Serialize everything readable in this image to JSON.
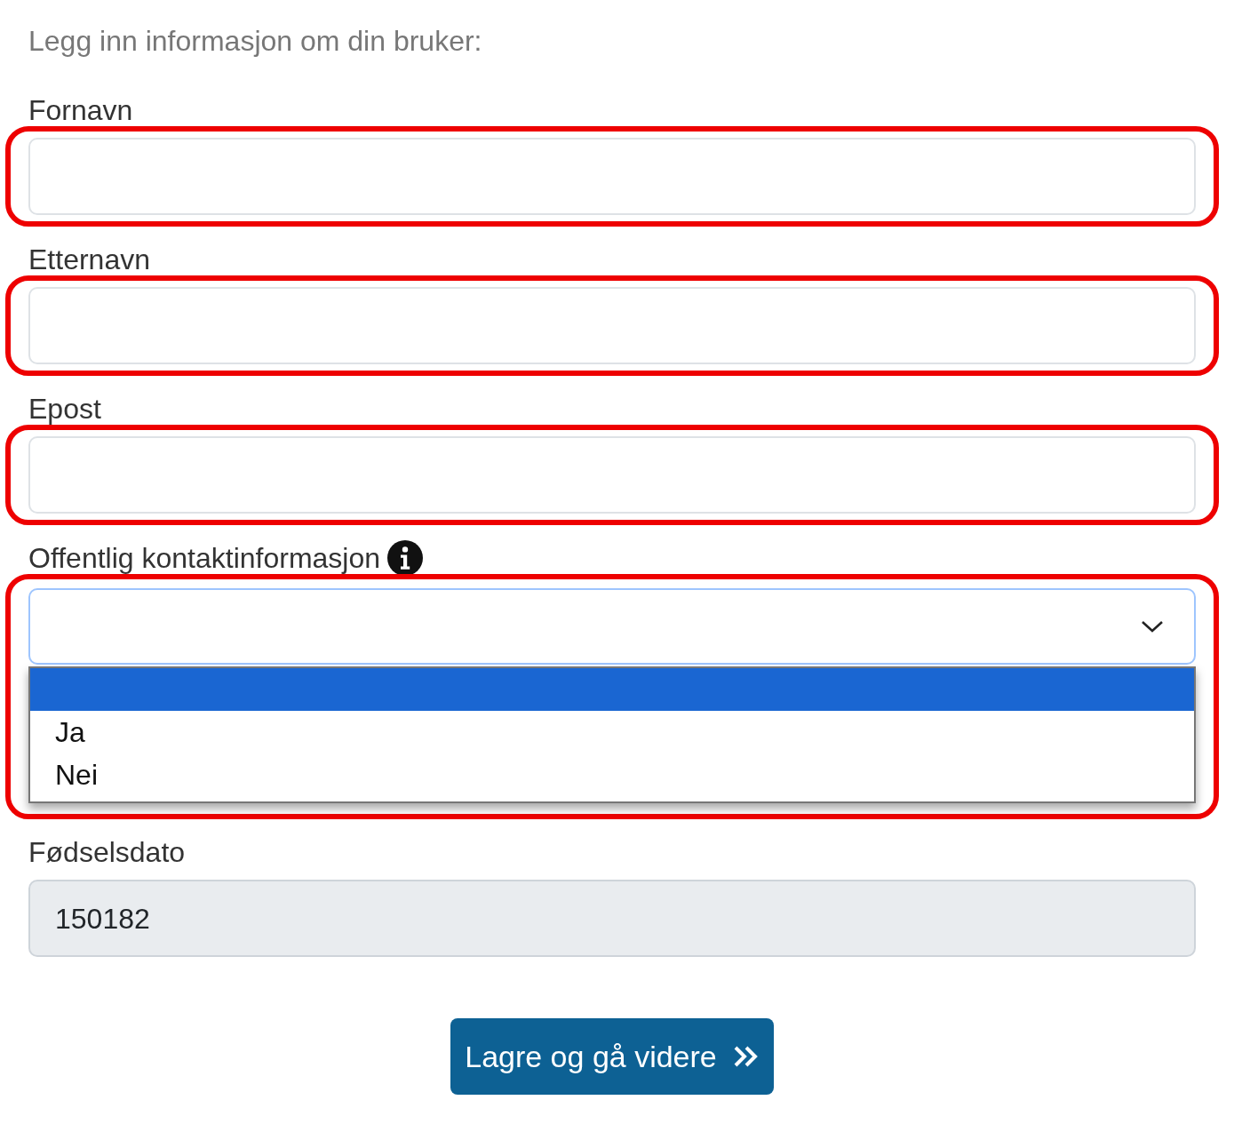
{
  "intro": "Legg inn informasjon om din bruker:",
  "fields": [
    {
      "kind": "text",
      "label": "Fornavn",
      "highlighted": true,
      "disabled": false
    },
    {
      "kind": "text",
      "label": "Etternavn",
      "highlighted": true,
      "disabled": false
    },
    {
      "kind": "text",
      "label": "Epost",
      "highlighted": true,
      "disabled": false
    },
    {
      "kind": "select",
      "label": "Offentlig kontaktinformasjon",
      "info_icon": true,
      "highlighted": true,
      "expanded": true,
      "options": [
        {
          "selected": true
        },
        {
          "label": "Ja",
          "selected": false
        },
        {
          "label": "Nei",
          "selected": false
        }
      ]
    },
    {
      "kind": "text",
      "label": "Fødselsdato",
      "value": "150182",
      "disabled": true
    }
  ],
  "button": {
    "label": "Lagre og gå videre"
  }
}
